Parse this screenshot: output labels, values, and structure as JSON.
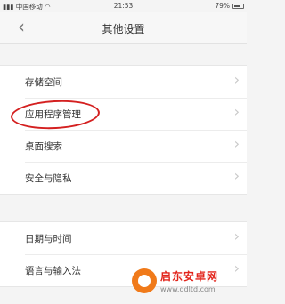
{
  "status_bar": {
    "carrier": "中国移动",
    "time": "21:53",
    "battery": "79%"
  },
  "nav": {
    "title": "其他设置"
  },
  "sections": [
    {
      "items": [
        "存储空间",
        "应用程序管理",
        "桌面搜索",
        "安全与隐私"
      ]
    },
    {
      "items": [
        "日期与时间",
        "语言与输入法"
      ]
    }
  ],
  "watermark": {
    "title": "启东安卓网",
    "url": "www.qdltd.com"
  },
  "colors": {
    "highlight": "#d42020",
    "watermark_red": "#e2231a",
    "watermark_orange": "#f07a1a"
  },
  "battery_level": 0.79
}
